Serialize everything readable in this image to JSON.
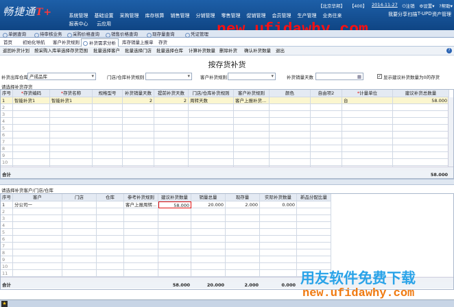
{
  "app": {
    "logo_text": "畅捷通",
    "logo_mark": "T+",
    "menu_row1": [
      "系统管理",
      "基础设置",
      "采购管理",
      "库存核算",
      "销售管理",
      "分销管理",
      "零售管理",
      "促销管理",
      "会员管理",
      "生产管理",
      "业务往来"
    ],
    "menu_row2": [
      "报表中心",
      "云应用"
    ],
    "right_menu": [
      "我要分享",
      "扫描",
      "T-UPD",
      "资产管理"
    ],
    "status_company": "【北京华邦】",
    "status_code": "【400】",
    "status_date": "2014-11-27",
    "status_logout": "注销",
    "status_settings": "设置",
    "status_help": "帮助"
  },
  "watermark_top": "new.ufidawhy.com",
  "watermark_cn": "用友软件免费下载",
  "watermark_bottom": "new.ufidawhy.com",
  "tabs": [
    "单据查询",
    "待审核业务",
    "采购价格查询",
    "销售价格查询",
    "现存量查询",
    "凭证管理"
  ],
  "tabs2": [
    "首页",
    "初始化导航",
    "客户补货规则",
    "补货需求分析",
    "库存销量上报单",
    "存货"
  ],
  "toolbar": [
    "返回补货计划",
    "按采购入库单选择存货范围",
    "批量选择客户",
    "批量选择门店",
    "批量选择仓库",
    "计算补货数量",
    "删除补货",
    "确认补货数量",
    "退出"
  ],
  "page_title": "按存货补货",
  "filters": {
    "warehouse_label": "补货出库仓库",
    "warehouse_value": "产成品库",
    "store_rule_label": "门店/仓库补货规则",
    "store_rule_value": "",
    "customer_rule_label": "客户补货规则",
    "customer_rule_value": "",
    "sales_days_label": "补货销量天数",
    "sales_days_value": "",
    "show_label": "显示建议补货数量为0的存货",
    "show_checked": true
  },
  "upper": {
    "section_label": "请选择补货存货",
    "headers": [
      "序号",
      "存货编码",
      "存货名称",
      "规格型号",
      "补货销量天数",
      "提前补货天数",
      "门店/仓库补货规则",
      "客户补货规则",
      "颜色",
      "自由项2",
      "计量单位",
      "建议补货总数量"
    ],
    "rows": [
      [
        "1",
        "智能补货1",
        "智能补货1",
        "",
        "2",
        "2",
        "周转天数",
        "客户上报补货...",
        "",
        "",
        "台",
        "58.000"
      ]
    ],
    "empty_rows": [
      "2",
      "3",
      "4",
      "5",
      "6",
      "7",
      "8",
      "9",
      "10",
      "11"
    ],
    "sum_label": "合计",
    "sum_total": "58.000"
  },
  "lower": {
    "section_label": "请选择补货客户/门店/仓库",
    "headers": [
      "序号",
      "客户",
      "门店",
      "仓库",
      "参考补货规则",
      "建议补货数量",
      "销量总量",
      "现存量",
      "实际补货数量",
      "新品分配比量"
    ],
    "rows": [
      [
        "1",
        "分公司一",
        "",
        "",
        "客户上报周转...",
        "58.000",
        "20.000",
        "2.000",
        "0.000",
        ""
      ]
    ],
    "empty_rows": [
      "2",
      "3",
      "4",
      "5",
      "6",
      "7",
      "8",
      "9",
      "10",
      "11",
      "12"
    ],
    "sum_label": "合计",
    "sums": [
      "58.000",
      "20.000",
      "2.000",
      "0.000"
    ]
  }
}
